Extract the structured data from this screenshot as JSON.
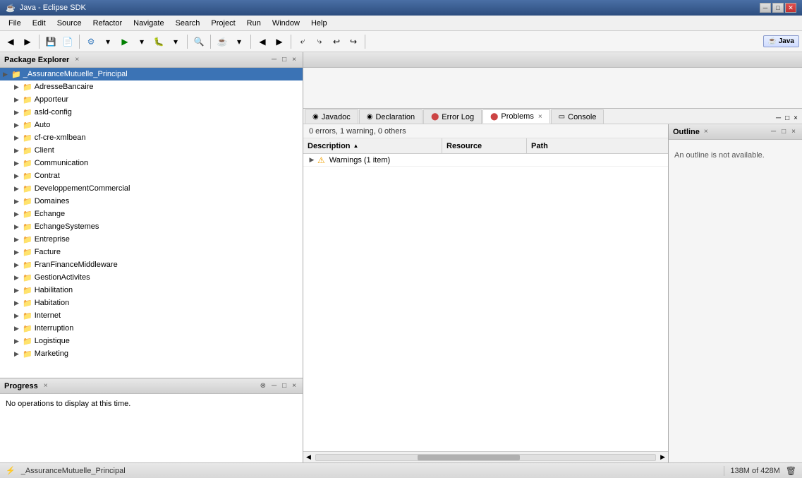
{
  "titlebar": {
    "title": "Java - Eclipse SDK",
    "icon": "☕",
    "min_label": "─",
    "max_label": "□",
    "close_label": "✕"
  },
  "menubar": {
    "items": [
      "File",
      "Edit",
      "Source",
      "Refactor",
      "Navigate",
      "Search",
      "Project",
      "Run",
      "Window",
      "Help"
    ]
  },
  "perspective": {
    "label": "Java"
  },
  "package_explorer": {
    "title": "Package Explorer",
    "items": [
      {
        "label": "_AssuranceMutuelle_Principal",
        "level": 0,
        "expanded": true,
        "type": "project",
        "selected": true
      },
      {
        "label": "AdresseBancaire",
        "level": 1,
        "type": "package"
      },
      {
        "label": "Apporteur",
        "level": 1,
        "type": "package"
      },
      {
        "label": "asld-config",
        "level": 1,
        "type": "package"
      },
      {
        "label": "Auto",
        "level": 1,
        "type": "package"
      },
      {
        "label": "cf-cre-xmlbean",
        "level": 1,
        "type": "package"
      },
      {
        "label": "Client",
        "level": 1,
        "type": "package"
      },
      {
        "label": "Communication",
        "level": 1,
        "type": "package"
      },
      {
        "label": "Contrat",
        "level": 1,
        "type": "package"
      },
      {
        "label": "DeveloppementCommercial",
        "level": 1,
        "type": "package"
      },
      {
        "label": "Domaines",
        "level": 1,
        "type": "package"
      },
      {
        "label": "Echange",
        "level": 1,
        "type": "package"
      },
      {
        "label": "EchangeSystemes",
        "level": 1,
        "type": "package"
      },
      {
        "label": "Entreprise",
        "level": 1,
        "type": "package"
      },
      {
        "label": "Facture",
        "level": 1,
        "type": "package"
      },
      {
        "label": "FranFinanceMiddleware",
        "level": 1,
        "type": "package"
      },
      {
        "label": "GestionActivites",
        "level": 1,
        "type": "package"
      },
      {
        "label": "Habilitation",
        "level": 1,
        "type": "package"
      },
      {
        "label": "Habitation",
        "level": 1,
        "type": "package"
      },
      {
        "label": "Internet",
        "level": 1,
        "type": "package"
      },
      {
        "label": "Interruption",
        "level": 1,
        "type": "package"
      },
      {
        "label": "Logistique",
        "level": 1,
        "type": "package"
      },
      {
        "label": "Marketing",
        "level": 1,
        "type": "package"
      }
    ]
  },
  "tabs": {
    "items": [
      {
        "id": "javadoc",
        "label": "Javadoc",
        "active": false
      },
      {
        "id": "declaration",
        "label": "Declaration",
        "active": false
      },
      {
        "id": "errorlog",
        "label": "Error Log",
        "active": false
      },
      {
        "id": "problems",
        "label": "Problems",
        "active": true,
        "closeable": true
      },
      {
        "id": "console",
        "label": "Console",
        "active": false
      }
    ]
  },
  "problems": {
    "status": "0 errors, 1 warning, 0 others",
    "columns": {
      "description": "Description",
      "resource": "Resource",
      "path": "Path"
    },
    "rows": [
      {
        "label": "Warnings (1 item)",
        "type": "warning",
        "expanded": false
      }
    ]
  },
  "outline": {
    "title": "Outline",
    "message": "An outline is not available."
  },
  "progress": {
    "title": "Progress",
    "message": "No operations to display at this time."
  },
  "statusbar": {
    "left_icon": "⚡",
    "project": "_AssuranceMutuelle_Principal",
    "memory": "138M of 428M"
  },
  "icons": {
    "arrow_right": "▶",
    "arrow_down": "▼",
    "folder": "📁",
    "package": "📦",
    "warning": "⚠",
    "close_x": "×",
    "minimize": "─",
    "maximize": "□",
    "restore": "❐"
  }
}
